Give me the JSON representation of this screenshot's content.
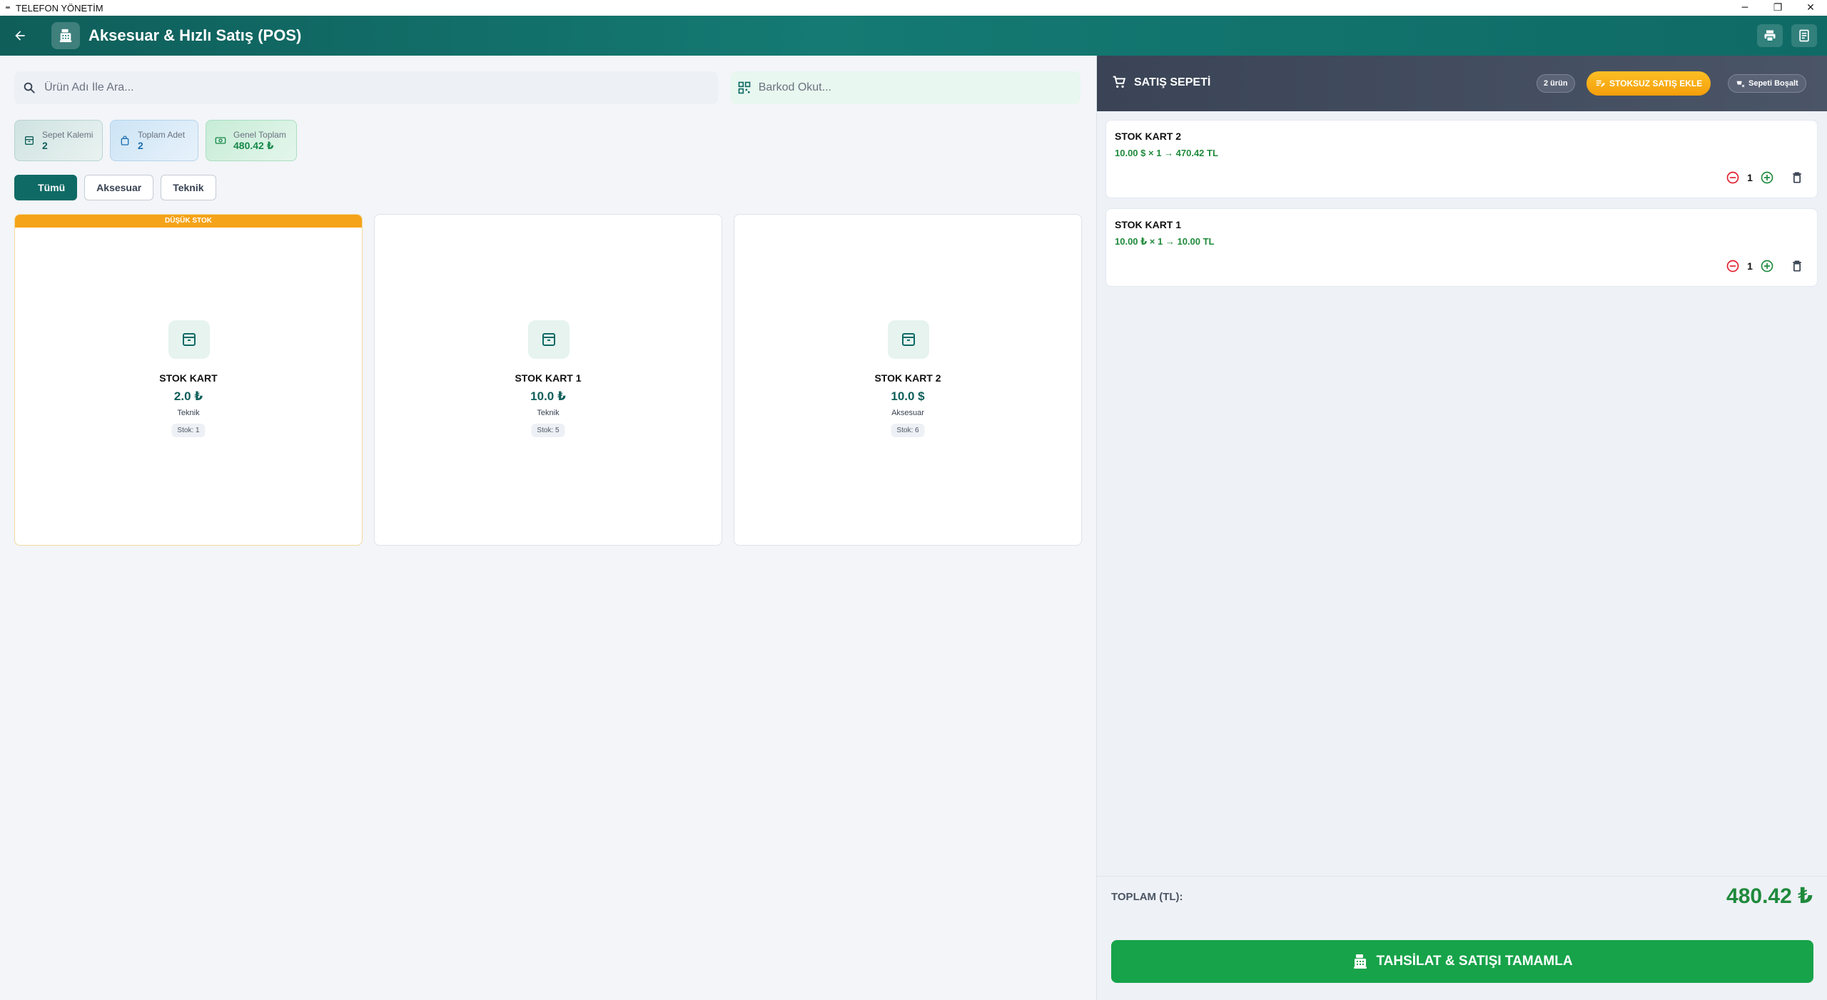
{
  "window": {
    "title": "TELEFON YÖNETİM",
    "minimize": "─",
    "restore": "❐",
    "close": "✕"
  },
  "header": {
    "title": "Aksesuar & Hızlı Satış (POS)"
  },
  "search": {
    "placeholder": "Ürün Adı İle Ara...",
    "icon": "search-icon"
  },
  "barcode": {
    "placeholder": "Barkod Okut...",
    "icon": "qr-code-icon"
  },
  "stats": [
    {
      "label": "Sepet Kalemi",
      "value": "2",
      "icon": "box-icon"
    },
    {
      "label": "Toplam Adet",
      "value": "2",
      "icon": "bag-icon"
    },
    {
      "label": "Genel Toplam",
      "value": "480.42 ₺",
      "icon": "money-icon"
    }
  ],
  "filters": [
    {
      "label": "Tümü",
      "active": true
    },
    {
      "label": "Aksesuar",
      "active": false
    },
    {
      "label": "Teknik",
      "active": false
    }
  ],
  "products": [
    {
      "banner": "DÜŞÜK STOK",
      "name": "STOK KART",
      "price": "2.0 ₺",
      "category": "Teknik",
      "stock": "Stok: 1"
    },
    {
      "name": "STOK KART 1",
      "price": "10.0 ₺",
      "category": "Teknik",
      "stock": "Stok: 5"
    },
    {
      "name": "STOK KART 2",
      "price": "10.0 $",
      "category": "Aksesuar",
      "stock": "Stok: 6"
    }
  ],
  "cart": {
    "title": "SATIŞ SEPETİ",
    "count_badge": "2 ürün",
    "add_noninventory": "STOKSUZ SATIŞ EKLE",
    "clear": "Sepeti Boşalt",
    "items": [
      {
        "name": "STOK KART 2",
        "line": "10.00 $ × 1 → 470.42 TL",
        "qty": "1"
      },
      {
        "name": "STOK KART 1",
        "line": "10.00 ₺ × 1 → 10.00 TL",
        "qty": "1"
      }
    ],
    "total_label": "TOPLAM (TL):",
    "total_value": "480.42 ₺",
    "checkout": "TAHSİLAT & SATIŞI TAMAMLA"
  },
  "colors": {
    "primary": "#0f6a65",
    "accent_green": "#17a34a",
    "warning": "#f5a318",
    "cart_header": "#3a4456"
  }
}
